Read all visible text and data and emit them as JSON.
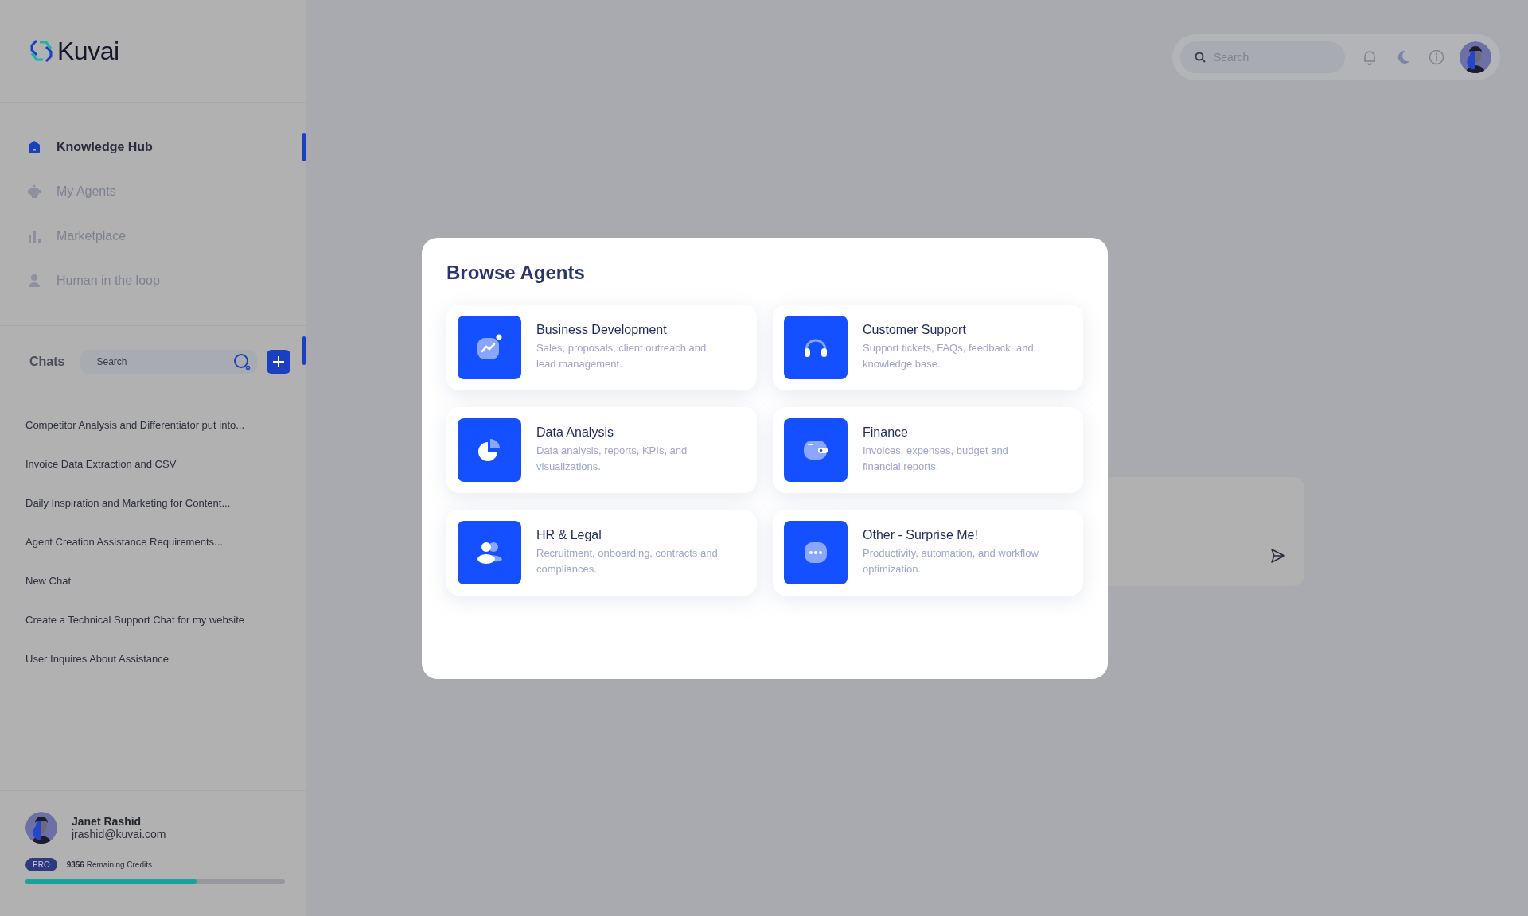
{
  "logo": {
    "text": "Kuvai"
  },
  "nav": [
    {
      "label": "Knowledge Hub",
      "selected": true
    },
    {
      "label": "My Agents",
      "selected": false
    },
    {
      "label": "Marketplace",
      "selected": false
    },
    {
      "label": "Human in the loop",
      "selected": false
    }
  ],
  "chats": {
    "title": "Chats",
    "search_placeholder": "Search",
    "items": [
      "Competitor Analysis and Differentiator put into...",
      "Invoice Data Extraction and CSV",
      "Daily Inspiration and Marketing for Content...",
      "Agent Creation Assistance Requirements...",
      "New Chat",
      "Create a Technical Support Chat for my website",
      "User Inquires About Assistance"
    ]
  },
  "user": {
    "name": "Janet Rashid",
    "email": "jrashid@kuvai.com",
    "plan": "PRO",
    "credits": "9356",
    "credits_label": "Remaining Credits",
    "level": 0.66
  },
  "topbar": {
    "search_placeholder": "Search"
  },
  "modal": {
    "title": "Browse Agents",
    "agents": [
      {
        "title": "Business Development",
        "description": "Sales, proposals, client outreach and lead management."
      },
      {
        "title": "Customer Support",
        "description": "Support tickets, FAQs, feedback, and knowledge base."
      },
      {
        "title": "Data Analysis",
        "description": "Data analysis, reports, KPIs, and visualizations."
      },
      {
        "title": "Finance",
        "description": "Invoices, expenses, budget and financial reports."
      },
      {
        "title": "HR & Legal",
        "description": "Recruitment, onboarding, contracts and compliances."
      },
      {
        "title": "Other - Surprise Me!",
        "description": "Productivity, automation, and workflow optimization."
      }
    ]
  }
}
